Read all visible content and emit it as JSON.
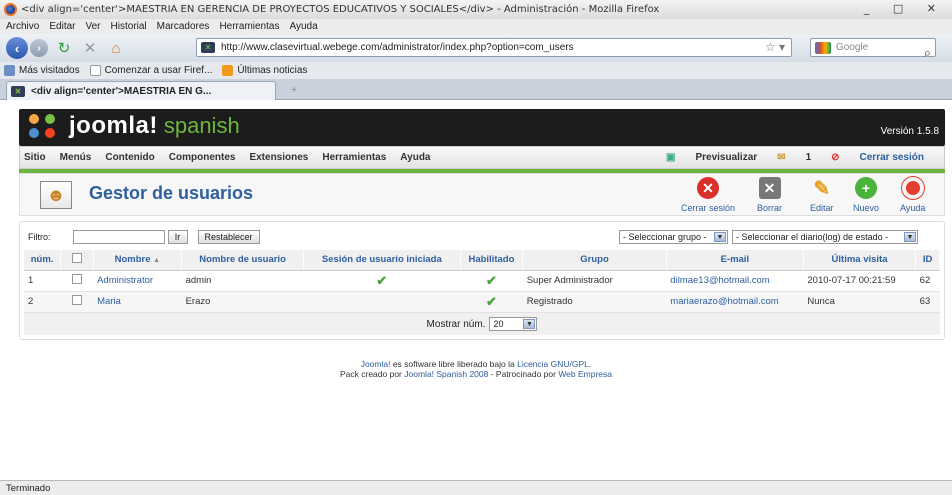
{
  "window": {
    "title": "<div align='center'>MAESTRIA EN GERENCIA DE PROYECTOS EDUCATIVOS Y SOCIALES</div> - Administración - Mozilla Firefox",
    "controls": "_ □ ✕"
  },
  "menubar": [
    "Archivo",
    "Editar",
    "Ver",
    "Historial",
    "Marcadores",
    "Herramientas",
    "Ayuda"
  ],
  "nav": {
    "url": "http://www.clasevirtual.webege.com/administrator/index.php?option=com_users",
    "search_placeholder": "Google"
  },
  "bookmarks": [
    "Más visitados",
    "Comenzar a usar Firef...",
    "Últimas noticias"
  ],
  "tab": {
    "label": "<div align='center'>MAESTRIA EN G..."
  },
  "joomla": {
    "logo": "joomla!",
    "logo_sub": "spanish",
    "version": "Versión 1.5.8",
    "menu": [
      "Sitio",
      "Menús",
      "Contenido",
      "Componentes",
      "Extensiones",
      "Herramientas",
      "Ayuda"
    ],
    "right": {
      "preview": "Previsualizar",
      "messages": "1",
      "logout": "Cerrar sesión"
    }
  },
  "page": {
    "title": "Gestor de usuarios",
    "toolbar": {
      "logout": "Cerrar sesión",
      "delete": "Borrar",
      "edit": "Editar",
      "new": "Nuevo",
      "help": "Ayuda"
    }
  },
  "filter": {
    "label": "Filtro:",
    "go": "Ir",
    "reset": "Restablecer",
    "group_select": "- Seleccionar grupo -",
    "log_select": "- Seleccionar el diario(log) de estado -"
  },
  "table": {
    "headers": {
      "num": "núm.",
      "name": "Nombre",
      "username": "Nombre de usuario",
      "logged": "Sesión de usuario iniciada",
      "enabled": "Habilitado",
      "group": "Grupo",
      "email": "E-mail",
      "last": "Última visita",
      "id": "ID"
    },
    "rows": [
      {
        "num": "1",
        "name": "Administrator",
        "username": "admin",
        "logged": "✔",
        "enabled": "✔",
        "group": "Super Administrador",
        "email": "dilmae13@hotmail.com",
        "last": "2010-07-17 00:21:59",
        "id": "62"
      },
      {
        "num": "2",
        "name": "Maria",
        "username": "Erazo",
        "logged": "",
        "enabled": "✔",
        "group": "Registrado",
        "email": "mariaerazo@hotmail.com",
        "last": "Nunca",
        "id": "63"
      }
    ]
  },
  "pager": {
    "label": "Mostrar núm.",
    "value": "20"
  },
  "footer": {
    "line1_a": "Joomla!",
    "line1_b": " es software libre liberado bajo la ",
    "line1_c": "Licencia GNU/GPL",
    "line1_d": ".",
    "line2_a": "Pack creado por ",
    "line2_b": "Joomla! Spanish 2008",
    "line2_c": " - Patrocinado por ",
    "line2_d": "Web Empresa"
  },
  "status": "Terminado"
}
